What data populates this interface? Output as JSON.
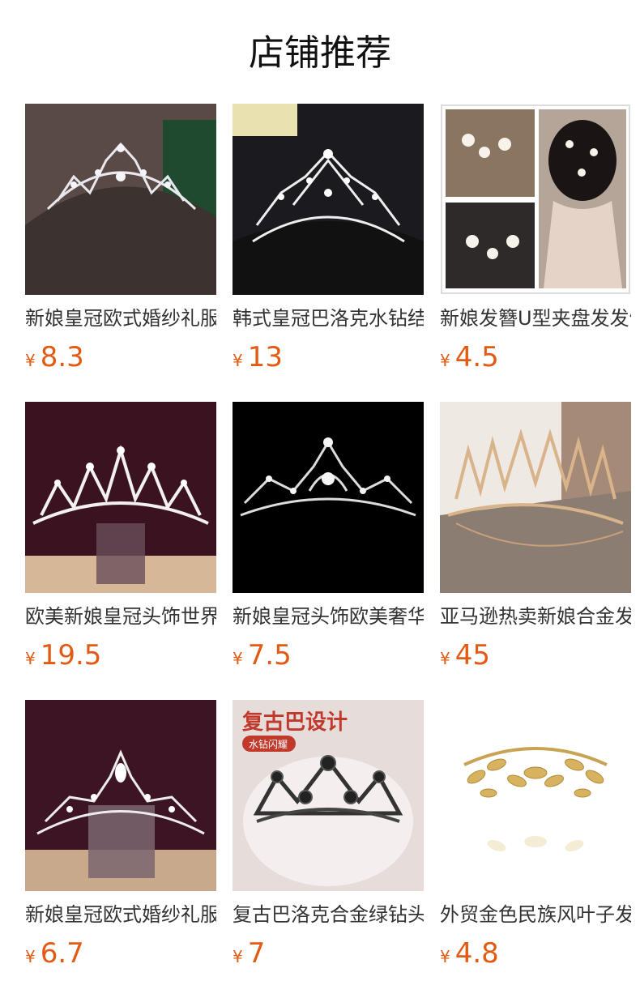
{
  "header": {
    "title": "店铺推荐"
  },
  "currency_symbol": "¥",
  "products": [
    {
      "name": "新娘皇冠欧式婚纱礼服",
      "price": "8.3"
    },
    {
      "name": "韩式皇冠巴洛克水钻结婚",
      "price": "13"
    },
    {
      "name": "新娘发簪U型夹盘发发饰",
      "price": "4.5"
    },
    {
      "name": "欧美新娘皇冠头饰世界",
      "price": "19.5"
    },
    {
      "name": "新娘皇冠头饰欧美奢华",
      "price": "7.5"
    },
    {
      "name": "亚马逊热卖新娘合金发饰",
      "price": "45"
    },
    {
      "name": "新娘皇冠欧式婚纱礼服",
      "price": "6.7"
    },
    {
      "name": "复古巴洛克合金绿钻头饰",
      "price": "7"
    },
    {
      "name": "外贸金色民族风叶子发箍",
      "price": "4.8"
    }
  ],
  "image_overlays": {
    "product_8_heading": "复古巴设计",
    "product_8_badge": "水钻闪耀"
  }
}
